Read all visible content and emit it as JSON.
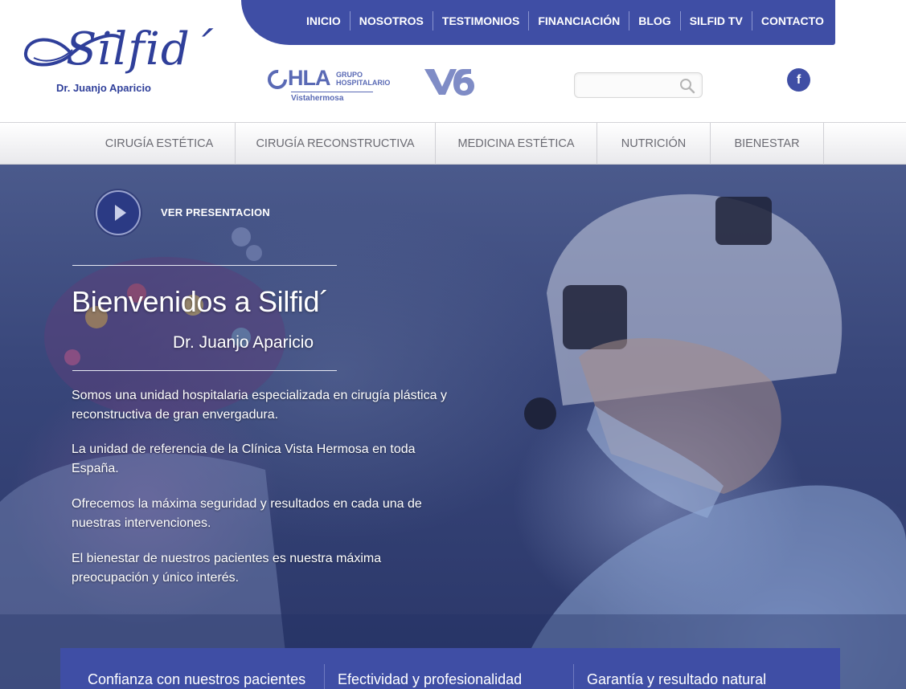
{
  "brand": {
    "logo_text": "Silfid´",
    "subtitle": "Dr. Juanjo Aparicio"
  },
  "topnav": {
    "items": [
      {
        "label": "INICIO"
      },
      {
        "label": "NOSOTROS"
      },
      {
        "label": "TESTIMONIOS"
      },
      {
        "label": "FINANCIACIÓN"
      },
      {
        "label": "BLOG"
      },
      {
        "label": "SILFID TV"
      },
      {
        "label": "CONTACTO"
      }
    ]
  },
  "partners": {
    "hla_letters": "HLA",
    "hla_group": "GRUPO HOSPITALARIO",
    "hla_location": "Vistahermosa",
    "v6_logo": "V6"
  },
  "search": {
    "value": "",
    "placeholder": "",
    "icon": "search-icon"
  },
  "social": {
    "facebook_glyph": "f",
    "icon": "facebook-icon"
  },
  "categories": [
    {
      "label": "CIRUGÍA ESTÉTICA"
    },
    {
      "label": "CIRUGÍA RECONSTRUCTIVA"
    },
    {
      "label": "MEDICINA ESTÉTICA"
    },
    {
      "label": "NUTRICIÓN"
    },
    {
      "label": "BIENESTAR"
    }
  ],
  "hero": {
    "play_label": "VER PRESENTACION",
    "title": "Bienvenidos a Silfid´",
    "subtitle": "Dr. Juanjo Aparicio",
    "paragraphs": [
      "Somos una unidad hospitalaria especializada en cirugía plástica y reconstructiva de gran envergadura.",
      "La unidad de referencia de la Clínica Vista Hermosa en toda España.",
      "Ofrecemos la máxima seguridad y resultados en cada una de nuestras intervenciones.",
      "El bienestar de nuestros pacientes es nuestra máxima preocupación y único interés."
    ]
  },
  "features": [
    {
      "label": "Confianza con nuestros pacientes"
    },
    {
      "label": "Efectividad y profesionalidad"
    },
    {
      "label": "Garantía y resultado natural"
    }
  ],
  "colors": {
    "brand_blue": "#3f4ea5",
    "logo_blue": "#2f3f9a",
    "hero_tint": "#38467a"
  }
}
